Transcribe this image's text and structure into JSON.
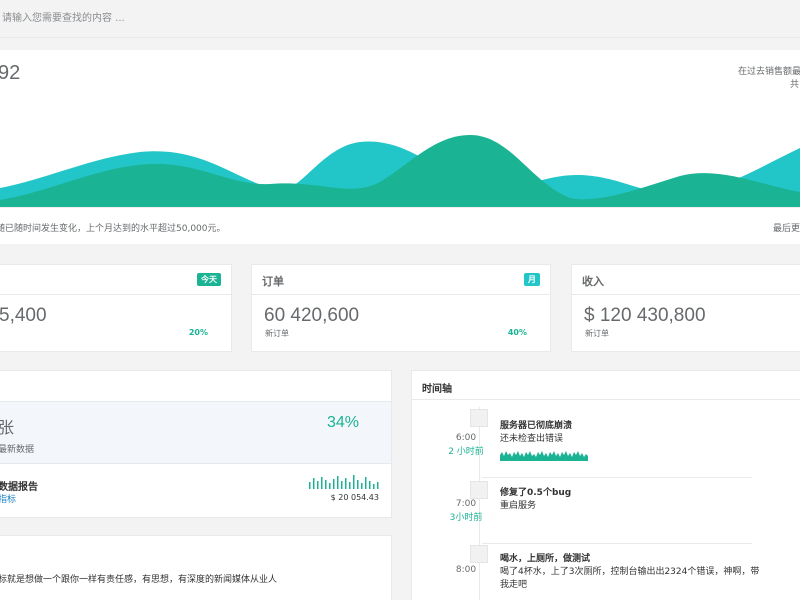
{
  "search": {
    "placeholder": "请输入您需要查找的内容 ..."
  },
  "hero": {
    "big_number": "92",
    "meta_line1": "在过去销售额最高",
    "meta_line2": "共",
    "footer_left": "随已随时间发生变化，上个月达到的水平超过50,000元。",
    "footer_right": "最后更",
    "colors": {
      "teal": "#23c6c8",
      "green": "#1ab394"
    }
  },
  "cards": [
    {
      "title": "",
      "badge": "今天",
      "value": "5,400",
      "sub": "",
      "pct": "20%"
    },
    {
      "title": "订单",
      "badge": "月",
      "value": "60 420,600",
      "sub": "新订单",
      "pct": "40%"
    },
    {
      "title": "收入",
      "badge": "",
      "value": "$ 120 430,800",
      "sub": "新订单",
      "pct": ""
    }
  ],
  "left_panel": {
    "highlight_big": "张",
    "highlight_sub": "最新数据",
    "highlight_pct": "34%",
    "report_title": "数据报告",
    "report_link": "指标",
    "report_amount": "$ 20 054.43"
  },
  "news_panel": {
    "text": "标就是想做一个跟你一样有责任感，有思想，有深度的新闻媒体从业人"
  },
  "timeline": {
    "title": "时间轴",
    "events": [
      {
        "time": "6:00",
        "ago": "2 小时前",
        "title": "服务器已彻底崩溃",
        "body": "还未检查出错误"
      },
      {
        "time": "7:00",
        "ago": "3小时前",
        "title": "修复了0.5个bug",
        "body": "重启服务"
      },
      {
        "time": "8:00",
        "ago": "",
        "title": "喝水，上厕所，做测试",
        "body": "喝了4杯水，上了3次厕所，控制台输出出2324个错误，神啊，带我走吧"
      }
    ]
  }
}
